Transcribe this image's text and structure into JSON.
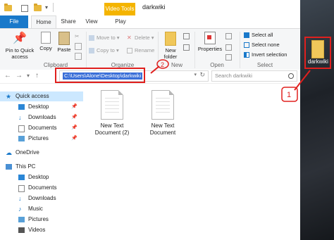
{
  "window": {
    "title": "darkwiki",
    "context_tab": "Video Tools"
  },
  "tabs": [
    {
      "label": "File"
    },
    {
      "label": "Home"
    },
    {
      "label": "Share"
    },
    {
      "label": "View"
    },
    {
      "label": "Play"
    }
  ],
  "ribbon": {
    "clipboard": {
      "label": "Clipboard",
      "pin": "Pin to Quick access",
      "copy": "Copy",
      "paste": "Paste"
    },
    "organize": {
      "label": "Organize",
      "move_to": "Move to",
      "copy_to": "Copy to",
      "delete": "Delete",
      "rename": "Rename"
    },
    "new": {
      "label": "New",
      "new_folder": "New folder"
    },
    "open": {
      "label": "Open",
      "properties": "Properties"
    },
    "select": {
      "label": "Select",
      "select_all": "Select all",
      "select_none": "Select none",
      "invert": "Invert selection"
    }
  },
  "address": {
    "path": "C:\\Users\\Alone\\Desktop\\darkwiki",
    "search_placeholder": "Search darkwiki"
  },
  "sidebar": {
    "quick_access": "Quick access",
    "items": [
      {
        "label": "Desktop"
      },
      {
        "label": "Downloads"
      },
      {
        "label": "Documents"
      },
      {
        "label": "Pictures"
      }
    ],
    "onedrive": "OneDrive",
    "this_pc": "This PC",
    "pc_items": [
      {
        "label": "Desktop"
      },
      {
        "label": "Documents"
      },
      {
        "label": "Downloads"
      },
      {
        "label": "Music"
      },
      {
        "label": "Pictures"
      },
      {
        "label": "Videos"
      }
    ]
  },
  "files": [
    {
      "name": "New Text Document (2)"
    },
    {
      "name": "New Text Document"
    }
  ],
  "desktop": {
    "folder": "darkwiki"
  },
  "annotations": {
    "num1": "1",
    "num2": "2"
  },
  "colors": {
    "accent": "#1979ca",
    "highlight": "#cce8ff",
    "context": "#f4b400",
    "annotation": "#e0201e"
  }
}
